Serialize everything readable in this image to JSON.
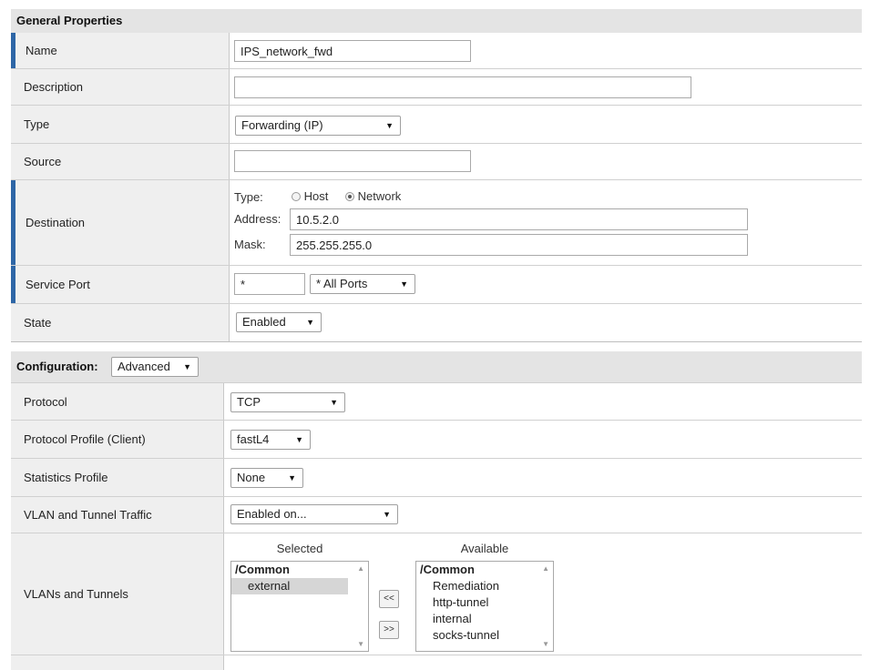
{
  "general": {
    "header": "General Properties",
    "name_label": "Name",
    "name_value": "IPS_network_fwd",
    "description_label": "Description",
    "description_value": "",
    "type_label": "Type",
    "type_value": "Forwarding (IP)",
    "source_label": "Source",
    "source_value": "",
    "destination_label": "Destination",
    "dest_type_label": "Type:",
    "dest_host_label": "Host",
    "dest_network_label": "Network",
    "dest_type_selected": "Network",
    "dest_address_label": "Address:",
    "dest_address_value": "10.5.2.0",
    "dest_mask_label": "Mask:",
    "dest_mask_value": "255.255.255.0",
    "service_port_label": "Service Port",
    "service_port_value": "*",
    "service_port_select": "* All Ports",
    "state_label": "State",
    "state_value": "Enabled"
  },
  "configuration": {
    "header": "Configuration:",
    "mode_value": "Advanced",
    "protocol_label": "Protocol",
    "protocol_value": "TCP",
    "protocol_profile_label": "Protocol Profile (Client)",
    "protocol_profile_value": "fastL4",
    "statistics_profile_label": "Statistics Profile",
    "statistics_profile_value": "None",
    "vlan_traffic_label": "VLAN and Tunnel Traffic",
    "vlan_traffic_value": "Enabled on...",
    "vlans_label": "VLANs and Tunnels",
    "selected_header": "Selected",
    "available_header": "Available",
    "selected_items": [
      "/Common",
      "external"
    ],
    "available_items": [
      "/Common",
      "Remediation",
      "http-tunnel",
      "internal",
      "socks-tunnel"
    ],
    "move_left_label": "<<",
    "move_right_label": ">>"
  },
  "icons": {
    "dropdown": "caret-down-icon",
    "scroll_up": "scroll-up-icon",
    "scroll_down": "scroll-down-icon"
  },
  "colors": {
    "accent": "#2e66a6",
    "label_bg": "#efefef",
    "header_bg": "#e4e4e4"
  }
}
